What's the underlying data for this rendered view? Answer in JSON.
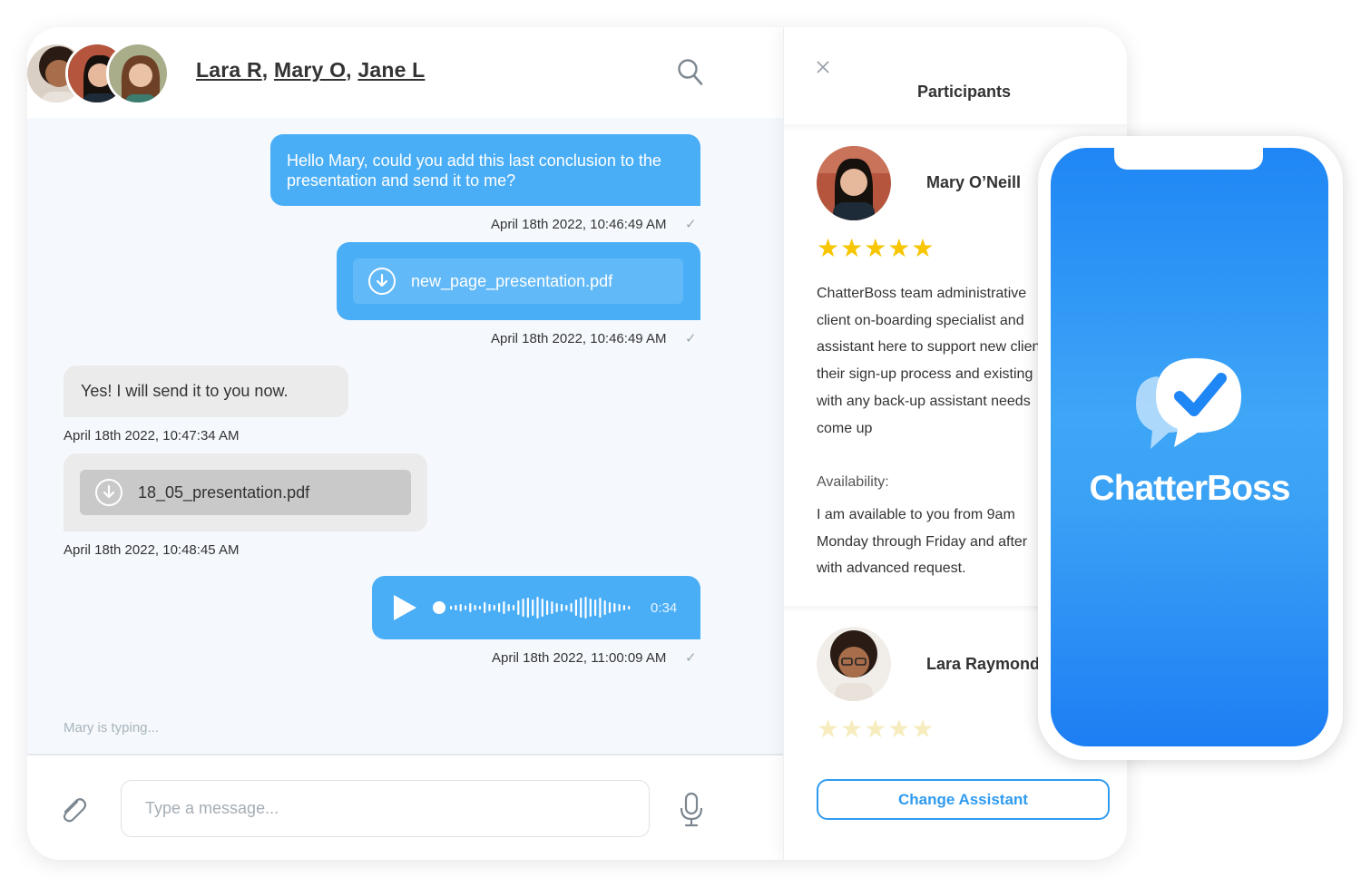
{
  "chat": {
    "title_parts": [
      "Lara R",
      "Mary O",
      "Jane L"
    ],
    "title_separator": ", ",
    "avatars": [
      "Lara R avatar",
      "Mary O avatar",
      "Jane L avatar"
    ],
    "messages": [
      {
        "text": "Hello Mary, could you add this last conclusion to the presentation and send it to me?",
        "timestamp": "April 18th 2022, 10:46:49 AM"
      },
      {
        "file": "new_page_presentation.pdf",
        "timestamp": "April 18th 2022, 10:46:49 AM"
      },
      {
        "text": "Yes! I will send it to you now.",
        "timestamp": "April 18th 2022, 10:47:34 AM"
      },
      {
        "file": "18_05_presentation.pdf",
        "timestamp": "April 18th 2022, 10:48:45 AM"
      },
      {
        "audio_duration": "0:34",
        "timestamp": "April 18th 2022, 11:00:09 AM"
      }
    ],
    "read_mark": "✓",
    "typing": "Mary is typing...",
    "composer": {
      "placeholder": "Type a message..."
    },
    "icons": {
      "search": "search-icon",
      "attach": "paperclip-icon",
      "mic": "microphone-icon",
      "download": "download-icon",
      "play": "play-icon"
    }
  },
  "participants": {
    "title": "Participants",
    "close_icon": "close-icon",
    "people": [
      {
        "name": "Mary O’Neill",
        "rating": 5,
        "stars": "★★★★★",
        "bio_lines": [
          "ChatterBoss team administrative",
          "client on-boarding specialist and",
          "assistant here to support new clients",
          "their sign-up process and existing",
          "with any back-up assistant needs",
          "come up"
        ],
        "availability_label": "Availability:",
        "availability_lines": [
          "I am available to you from 9am",
          "Monday through Friday and after",
          "with advanced request."
        ]
      },
      {
        "name": "Lara Raymond",
        "rating": 0,
        "stars": "★★★★★"
      }
    ],
    "change_button": "Change Assistant"
  },
  "phone": {
    "brand": "ChatterBoss",
    "colors": {
      "top": "#1f86f5",
      "bottom": "#1c7ef3"
    }
  },
  "colors": {
    "outgoing": "#4aaef7",
    "incoming": "#ebebeb",
    "accent": "#2f9bf0",
    "star": "#f7c600"
  }
}
